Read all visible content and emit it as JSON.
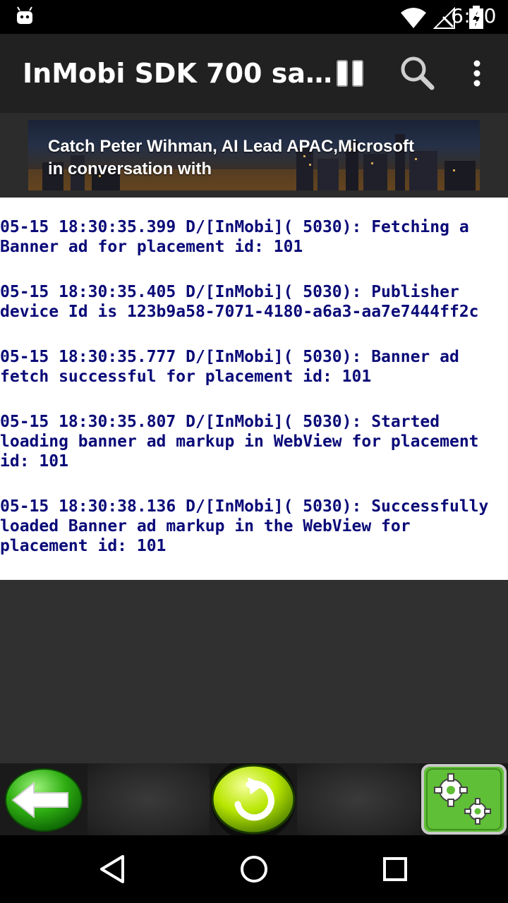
{
  "status_bar": {
    "time": "6:30",
    "icons": [
      "android-notification-icon",
      "wifi-icon",
      "no-signal-icon",
      "battery-charging-icon"
    ]
  },
  "app_bar": {
    "title": "InMobi SDK 700 sa…",
    "actions": [
      "pause-icon",
      "search-icon",
      "overflow-menu-icon"
    ]
  },
  "banner_ad": {
    "line1": "Catch Peter Wihman, AI Lead APAC,Microsoft",
    "line2": "in conversation with"
  },
  "log": {
    "entries": [
      "05-15 18:30:35.399 D/[InMobi]( 5030): Fetching a Banner ad for placement id: 101",
      "05-15 18:30:35.405 D/[InMobi]( 5030): Publisher device Id is 123b9a58-7071-4180-a6a3-aa7e7444ff2c",
      "05-15 18:30:35.777 D/[InMobi]( 5030): Banner ad fetch successful for placement id: 101",
      "05-15 18:30:35.807 D/[InMobi]( 5030): Started loading banner ad markup in WebView for placement id: 101",
      "05-15 18:30:38.136 D/[InMobi]( 5030): Successfully loaded Banner ad markup in the WebView for placement id: 101"
    ]
  },
  "toolbar": {
    "buttons": [
      "back-arrow-icon",
      "refresh-icon",
      "settings-gears-icon"
    ],
    "colors": {
      "green": "#3fbf1f",
      "lime": "#c8f000"
    }
  },
  "nav_bar": {
    "buttons": [
      "back-triangle-icon",
      "home-circle-icon",
      "recents-square-icon"
    ]
  }
}
